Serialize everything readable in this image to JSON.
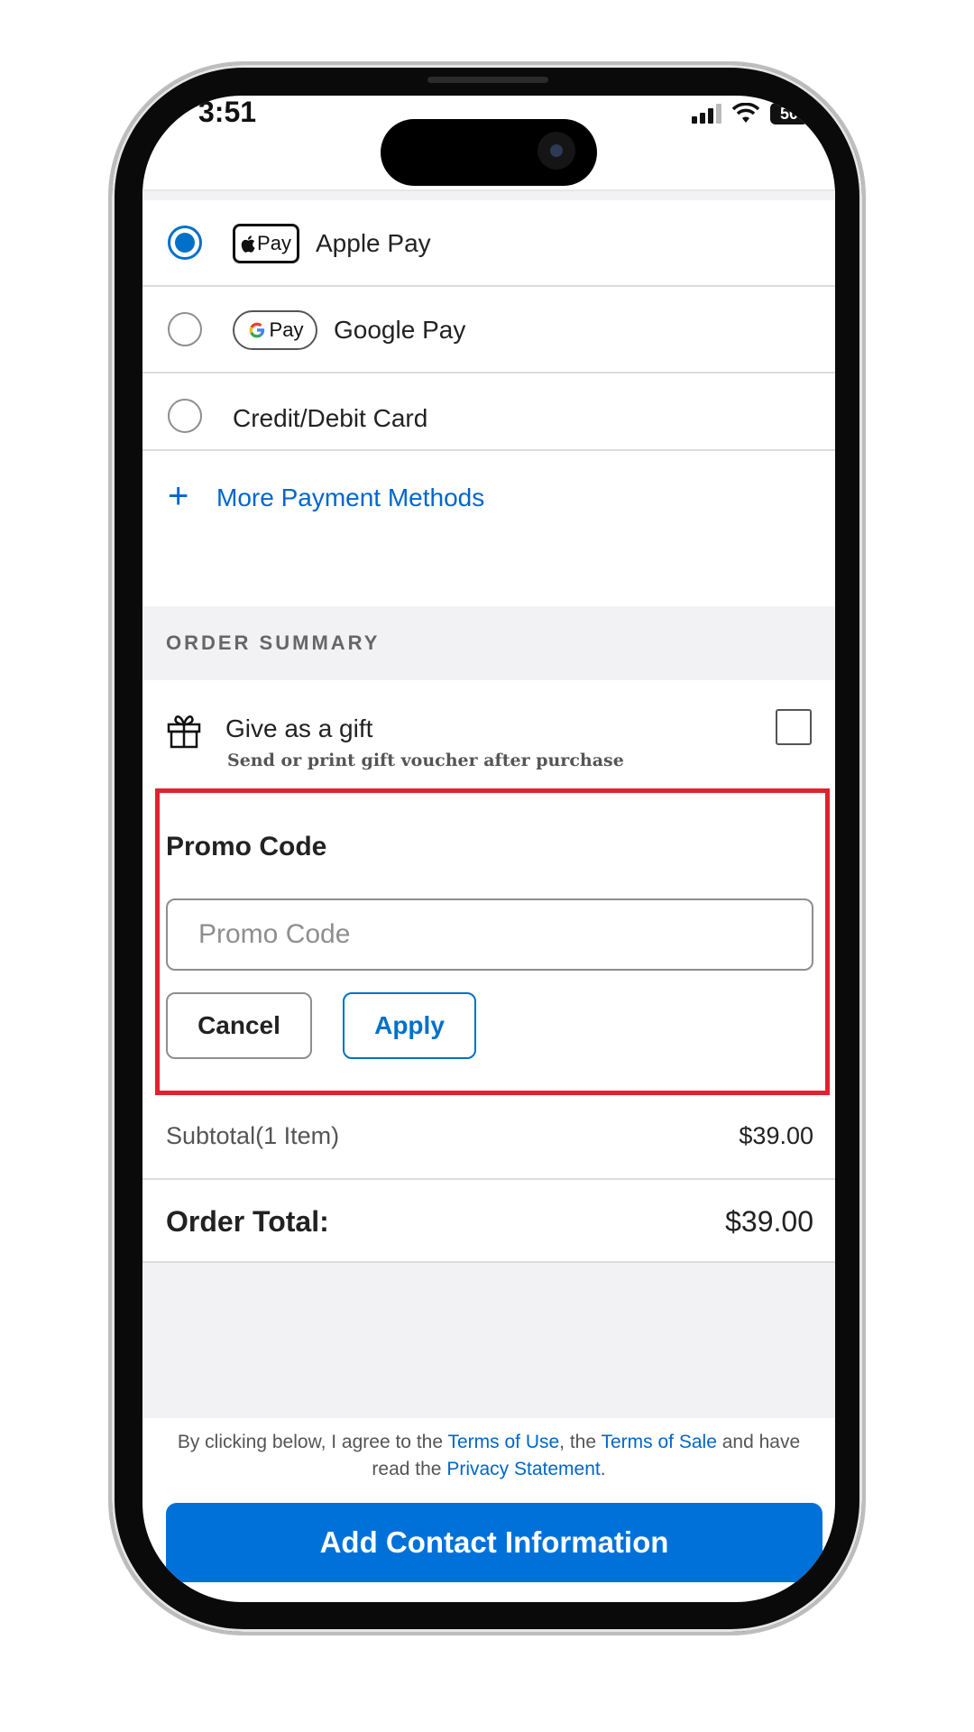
{
  "status_bar": {
    "time": "3:51",
    "battery": "50"
  },
  "payment": {
    "options": [
      {
        "label": "Apple Pay",
        "badge": "Pay",
        "selected": true
      },
      {
        "label": "Google Pay",
        "badge": "Pay",
        "selected": false
      },
      {
        "label": "Credit/Debit Card",
        "selected": false
      }
    ],
    "more_label": "More Payment Methods"
  },
  "order_summary": {
    "heading": "ORDER SUMMARY",
    "gift": {
      "title": "Give as a gift",
      "subtitle": "Send or print gift voucher after purchase"
    },
    "promo": {
      "title": "Promo Code",
      "placeholder": "Promo Code",
      "cancel_label": "Cancel",
      "apply_label": "Apply"
    },
    "subtotal_label": "Subtotal(1 Item)",
    "subtotal_value": "$39.00",
    "total_label": "Order Total:",
    "total_value": "$39.00"
  },
  "legal": {
    "prefix": "By clicking below, I agree to the ",
    "terms_of_use": "Terms of Use",
    "mid1": ", the ",
    "terms_of_sale": "Terms of Sale",
    "mid2": " and have read the ",
    "privacy": "Privacy Statement",
    "suffix": "."
  },
  "cta_label": "Add Contact Information",
  "colors": {
    "accent": "#0070c9",
    "highlight": "#e4202e",
    "cta": "#0071d9"
  }
}
